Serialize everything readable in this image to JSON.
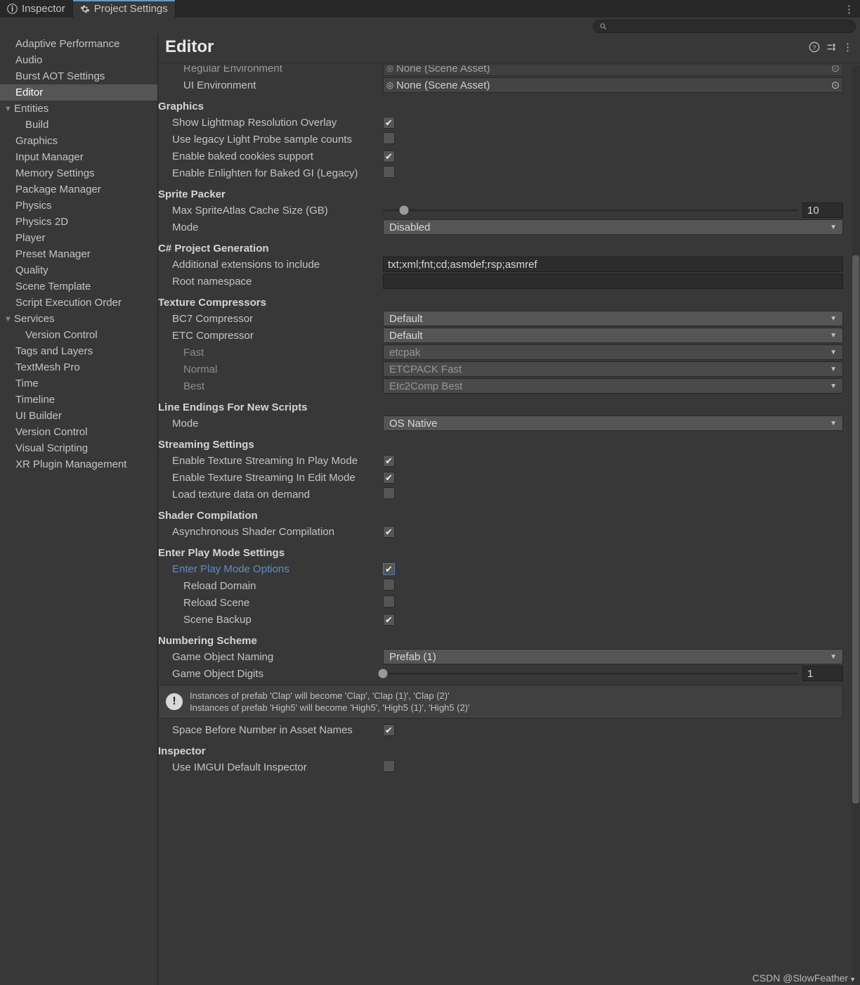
{
  "tabs": {
    "inspector": "Inspector",
    "project_settings": "Project Settings"
  },
  "search": {
    "placeholder": ""
  },
  "sidebar": {
    "items": [
      {
        "label": "Adaptive Performance"
      },
      {
        "label": "Audio"
      },
      {
        "label": "Burst AOT Settings"
      },
      {
        "label": "Editor",
        "selected": true
      },
      {
        "label": "Entities",
        "fold": true,
        "children": [
          {
            "label": "Build"
          }
        ]
      },
      {
        "label": "Graphics"
      },
      {
        "label": "Input Manager"
      },
      {
        "label": "Memory Settings"
      },
      {
        "label": "Package Manager"
      },
      {
        "label": "Physics"
      },
      {
        "label": "Physics 2D"
      },
      {
        "label": "Player"
      },
      {
        "label": "Preset Manager"
      },
      {
        "label": "Quality"
      },
      {
        "label": "Scene Template"
      },
      {
        "label": "Script Execution Order"
      },
      {
        "label": "Services",
        "fold": true,
        "children": [
          {
            "label": "Version Control"
          }
        ]
      },
      {
        "label": "Tags and Layers"
      },
      {
        "label": "TextMesh Pro"
      },
      {
        "label": "Time"
      },
      {
        "label": "Timeline"
      },
      {
        "label": "UI Builder"
      },
      {
        "label": "Version Control"
      },
      {
        "label": "Visual Scripting"
      },
      {
        "label": "XR Plugin Management"
      }
    ]
  },
  "page": {
    "title": "Editor"
  },
  "fields": {
    "regular_env": {
      "label": "Regular Environment",
      "value": "None (Scene Asset)"
    },
    "ui_env": {
      "label": "UI Environment",
      "value": "None (Scene Asset)"
    },
    "graphics_h": "Graphics",
    "show_lightmap": {
      "label": "Show Lightmap Resolution Overlay",
      "value": true
    },
    "legacy_lp": {
      "label": "Use legacy Light Probe sample counts",
      "value": false
    },
    "baked_cookies": {
      "label": "Enable baked cookies support",
      "value": true
    },
    "enlighten": {
      "label": "Enable Enlighten for Baked GI (Legacy)",
      "value": false
    },
    "sprite_h": "Sprite Packer",
    "atlas_cache": {
      "label": "Max SpriteAtlas Cache Size (GB)",
      "value": "10",
      "pos": 5
    },
    "sp_mode": {
      "label": "Mode",
      "value": "Disabled"
    },
    "csproj_h": "C# Project Generation",
    "add_ext": {
      "label": "Additional extensions to include",
      "value": "txt;xml;fnt;cd;asmdef;rsp;asmref"
    },
    "root_ns": {
      "label": "Root namespace",
      "value": ""
    },
    "tex_h": "Texture Compressors",
    "bc7": {
      "label": "BC7 Compressor",
      "value": "Default"
    },
    "etc": {
      "label": "ETC Compressor",
      "value": "Default"
    },
    "etc_fast": {
      "label": "Fast",
      "value": "etcpak"
    },
    "etc_norm": {
      "label": "Normal",
      "value": "ETCPACK Fast"
    },
    "etc_best": {
      "label": "Best",
      "value": "Etc2Comp Best"
    },
    "le_h": "Line Endings For New Scripts",
    "le_mode": {
      "label": "Mode",
      "value": "OS Native"
    },
    "stream_h": "Streaming Settings",
    "ts_play": {
      "label": "Enable Texture Streaming In Play Mode",
      "value": true
    },
    "ts_edit": {
      "label": "Enable Texture Streaming In Edit Mode",
      "value": true
    },
    "ts_demand": {
      "label": "Load texture data on demand",
      "value": false
    },
    "shader_h": "Shader Compilation",
    "async_sh": {
      "label": "Asynchronous Shader Compilation",
      "value": true
    },
    "epm_h": "Enter Play Mode Settings",
    "epm_opt": {
      "label": "Enter Play Mode Options",
      "value": true
    },
    "rl_domain": {
      "label": "Reload Domain",
      "value": false
    },
    "rl_scene": {
      "label": "Reload Scene",
      "value": false
    },
    "scene_bk": {
      "label": "Scene Backup",
      "value": true
    },
    "num_h": "Numbering Scheme",
    "go_naming": {
      "label": "Game Object Naming",
      "value": "Prefab (1)"
    },
    "go_digits": {
      "label": "Game Object Digits",
      "value": "1",
      "pos": 0
    },
    "info_l1": "Instances of prefab 'Clap' will become 'Clap', 'Clap (1)', 'Clap (2)'",
    "info_l2": "Instances of prefab 'High5' will become 'High5', 'High5 (1)', 'High5 (2)'",
    "space_before": {
      "label": "Space Before Number in Asset Names",
      "value": true
    },
    "insp_h": "Inspector",
    "imgui": {
      "label": "Use IMGUI Default Inspector",
      "value": false
    }
  },
  "watermark": "CSDN @SlowFeather"
}
